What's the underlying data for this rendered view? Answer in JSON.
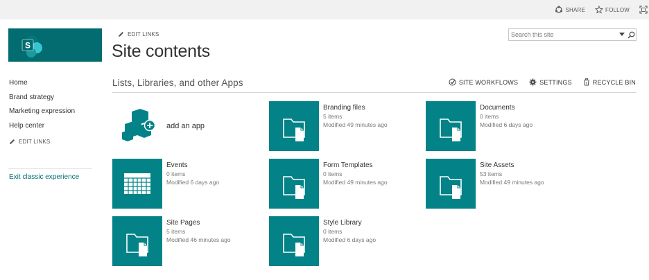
{
  "topbar": {
    "share_label": "SHARE",
    "follow_label": "FOLLOW"
  },
  "nav": {
    "items": [
      {
        "label": "Home"
      },
      {
        "label": "Brand strategy"
      },
      {
        "label": "Marketing expression"
      },
      {
        "label": "Help center"
      }
    ],
    "edit_links": "EDIT LINKS",
    "exit_classic": "Exit classic experience"
  },
  "header": {
    "edit_links": "EDIT LINKS",
    "title": "Site contents",
    "search_placeholder": "Search this site"
  },
  "section": {
    "title": "Lists, Libraries, and other Apps",
    "actions": {
      "workflows": "SITE WORKFLOWS",
      "settings": "SETTINGS",
      "recycle_bin": "RECYCLE BIN"
    }
  },
  "add_app": {
    "label": "add an app"
  },
  "tiles": [
    {
      "name": "Branding files",
      "items": "5 items",
      "modified": "Modified 49 minutes ago",
      "icon": "folder-doc-icon"
    },
    {
      "name": "Documents",
      "items": "0 items",
      "modified": "Modified 6 days ago",
      "icon": "folder-doc-icon"
    },
    {
      "name": "Events",
      "items": "0 items",
      "modified": "Modified 6 days ago",
      "icon": "calendar-icon"
    },
    {
      "name": "Form Templates",
      "items": "0 items",
      "modified": "Modified 49 minutes ago",
      "icon": "folder-doc-icon"
    },
    {
      "name": "Site Assets",
      "items": "53 items",
      "modified": "Modified 49 minutes ago",
      "icon": "folder-doc-icon"
    },
    {
      "name": "Site Pages",
      "items": "5 items",
      "modified": "Modified 46 minutes ago",
      "icon": "folder-doc-icon"
    },
    {
      "name": "Style Library",
      "items": "0 items",
      "modified": "Modified 6 days ago",
      "icon": "folder-doc-icon"
    }
  ],
  "colors": {
    "brand": "#036c70",
    "tile": "#038387",
    "link": "#036c70"
  }
}
